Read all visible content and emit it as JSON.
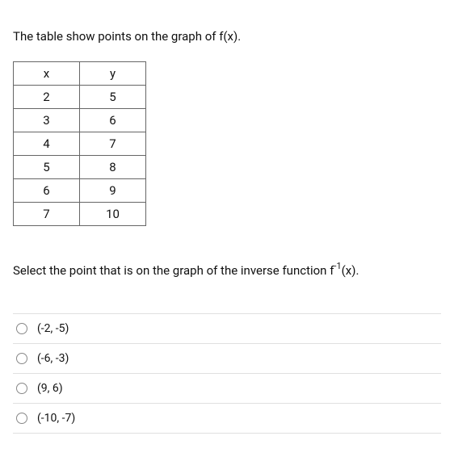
{
  "intro": "The table show points on the graph of f(x).",
  "table": {
    "headers": {
      "x": "x",
      "y": "y"
    },
    "rows": [
      {
        "x": "2",
        "y": "5"
      },
      {
        "x": "3",
        "y": "6"
      },
      {
        "x": "4",
        "y": "7"
      },
      {
        "x": "5",
        "y": "8"
      },
      {
        "x": "6",
        "y": "9"
      },
      {
        "x": "7",
        "y": "10"
      }
    ]
  },
  "question": {
    "prefix": "Select the point that is on the graph of the inverse function  f",
    "sup": "-1",
    "suffix": "(x)."
  },
  "options": [
    {
      "label": "(-2, -5)"
    },
    {
      "label": "(-6, -3)"
    },
    {
      "label": "(9, 6)"
    },
    {
      "label": "(-10, -7)"
    }
  ]
}
